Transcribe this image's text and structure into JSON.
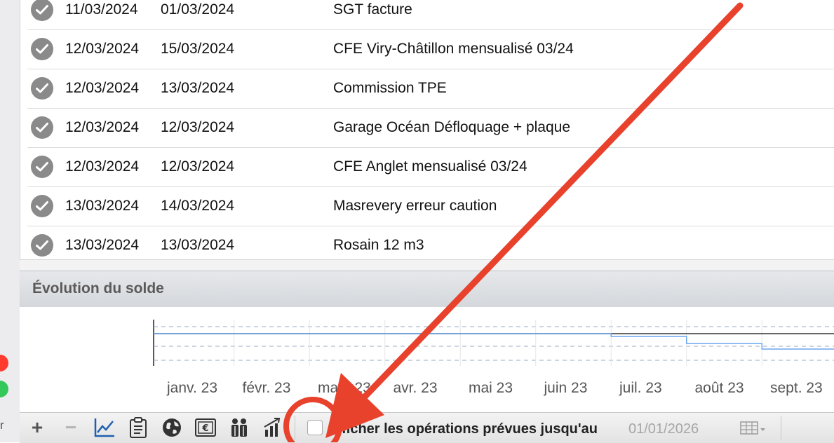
{
  "sidebar": {
    "truncated_label": "r"
  },
  "transactions": [
    {
      "date_op": "11/03/2024",
      "date_val": "01/03/2024",
      "label": "SGT facture"
    },
    {
      "date_op": "12/03/2024",
      "date_val": "15/03/2024",
      "label": "CFE Viry-Châtillon mensualisé 03/24"
    },
    {
      "date_op": "12/03/2024",
      "date_val": "13/03/2024",
      "label": "Commission TPE"
    },
    {
      "date_op": "12/03/2024",
      "date_val": "12/03/2024",
      "label": "Garage Océan Défloquage + plaque"
    },
    {
      "date_op": "12/03/2024",
      "date_val": "12/03/2024",
      "label": "CFE Anglet mensualisé 03/24"
    },
    {
      "date_op": "13/03/2024",
      "date_val": "14/03/2024",
      "label": "Masrevery erreur caution"
    },
    {
      "date_op": "13/03/2024",
      "date_val": "13/03/2024",
      "label": "Rosain 12 m3"
    }
  ],
  "chart_panel": {
    "title": "Évolution du solde"
  },
  "chart_data": {
    "type": "line",
    "categories": [
      "janv. 23",
      "févr. 23",
      "mars 23",
      "avr. 23",
      "mai 23",
      "juin 23",
      "juil. 23",
      "août 23",
      "sept. 23"
    ],
    "series": [
      {
        "values": [
          1,
          1,
          1,
          1,
          1,
          1,
          0.9,
          0.65,
          0.45
        ]
      }
    ],
    "grid": true,
    "colors": {
      "line": "#6aa6ee",
      "baseline": "#333333",
      "gridline": "#9aaec6"
    }
  },
  "toolbar": {
    "add_label": "+",
    "remove_label": "−",
    "checkbox_label": "Afficher les opérations prévues jusqu'au",
    "checkbox_checked": false,
    "date_value": "01/01/2026"
  },
  "icons": [
    "chart-line-icon",
    "clipboard-icon",
    "globe-icon",
    "euro-note-icon",
    "people-icon",
    "bar-chart-up-icon",
    "table-icon",
    "chevron-down-icon",
    "checkmark-icon"
  ],
  "colors": {
    "annotation_red": "#e8412c",
    "check_gray": "#8a8a8a"
  }
}
